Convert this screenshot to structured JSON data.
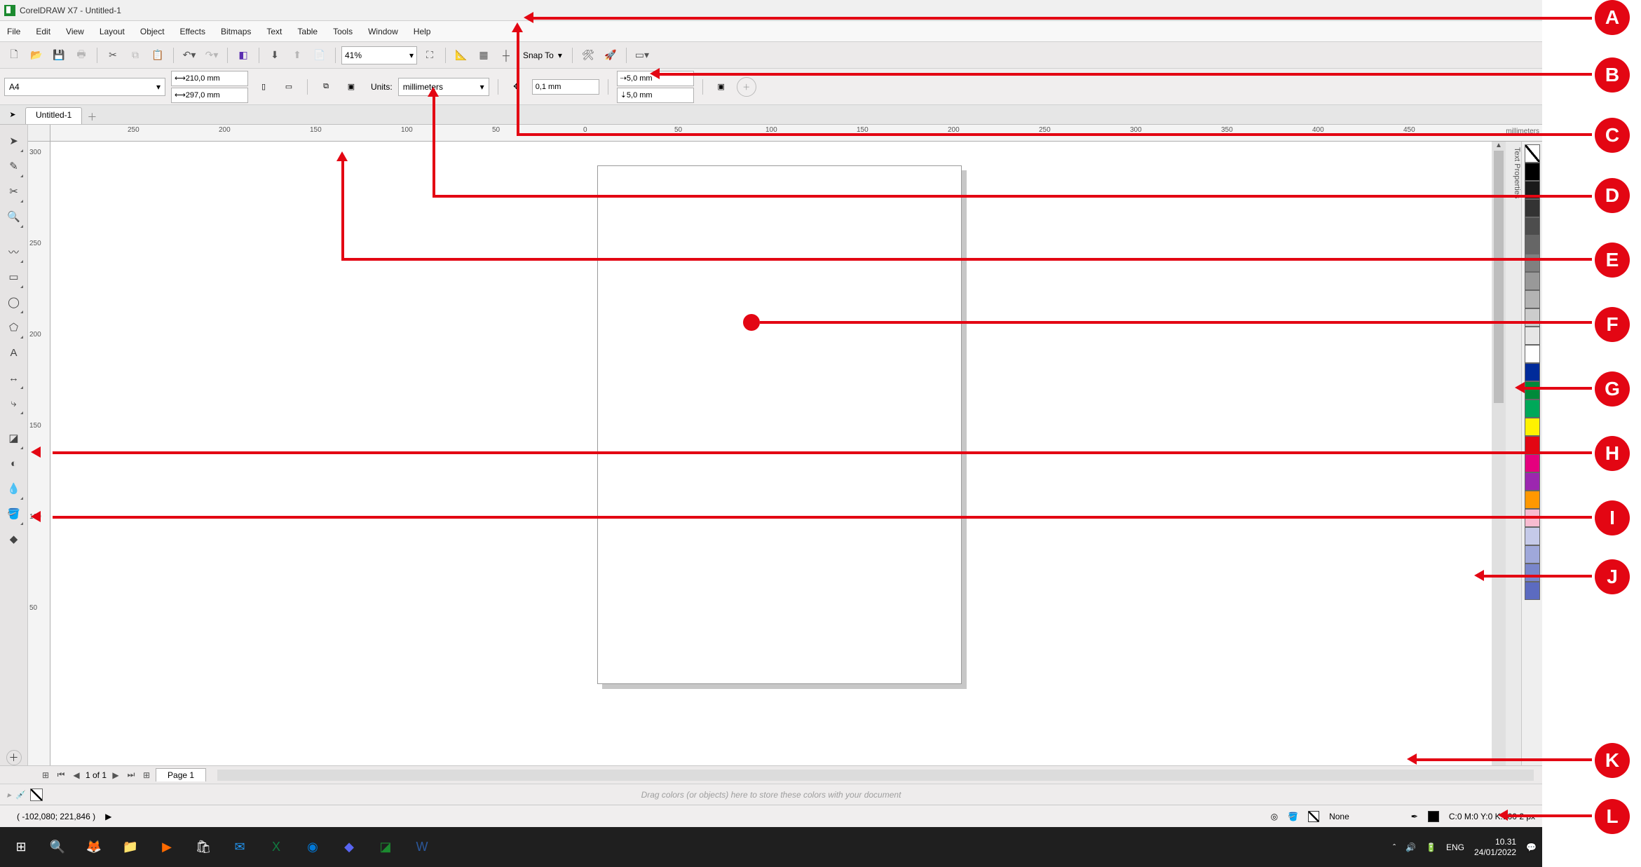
{
  "titlebar": {
    "app": "CorelDRAW X7",
    "doc": "Untitled-1"
  },
  "menus": [
    "File",
    "Edit",
    "View",
    "Layout",
    "Object",
    "Effects",
    "Bitmaps",
    "Text",
    "Table",
    "Tools",
    "Window",
    "Help"
  ],
  "toolbar": {
    "zoom_value": "41%",
    "snap_label": "Snap To"
  },
  "propbar": {
    "page_size": "A4",
    "width": "210,0 mm",
    "height": "297,0 mm",
    "units_label": "Units:",
    "units_value": "millimeters",
    "nudge_value": "0,1 mm",
    "dup_x": "5,0 mm",
    "dup_y": "5,0 mm"
  },
  "doctab": {
    "name": "Untitled-1"
  },
  "ruler": {
    "h_ticks": [
      "250",
      "200",
      "150",
      "100",
      "50",
      "0",
      "50",
      "100",
      "150",
      "200",
      "250",
      "300",
      "350",
      "400",
      "450"
    ],
    "h_unit": "millimeters",
    "v_ticks": [
      "300",
      "250",
      "200",
      "150",
      "100",
      "50"
    ]
  },
  "right_panel_label": "Text Properties",
  "palette_colors": [
    "none",
    "#000000",
    "#1a1a1a",
    "#333333",
    "#4d4d4d",
    "#666666",
    "#808080",
    "#999999",
    "#b3b3b3",
    "#cccccc",
    "#e6e6e6",
    "#ffffff",
    "#002b9a",
    "#008a3a",
    "#00a859",
    "#fff200",
    "#e30613",
    "#e5007e",
    "#9c27b0",
    "#ff9800",
    "#f8bbd0",
    "#c5cae9",
    "#9fa8da",
    "#7986cb",
    "#5c6bc0"
  ],
  "pagenav": {
    "counter": "1 of 1",
    "tab": "Page 1"
  },
  "docpalette_hint": "Drag colors (or objects) here to store these colors with your document",
  "status": {
    "coords": "( -102,080; 221,846 )",
    "fill_label": "None",
    "outline": "C:0 M:0 Y:0 K:100  2 px"
  },
  "taskbar": {
    "lang": "ENG",
    "time": "10.31",
    "date": "24/01/2022"
  },
  "badges": [
    "A",
    "B",
    "C",
    "D",
    "E",
    "F",
    "G",
    "H",
    "I",
    "J",
    "K",
    "L"
  ]
}
